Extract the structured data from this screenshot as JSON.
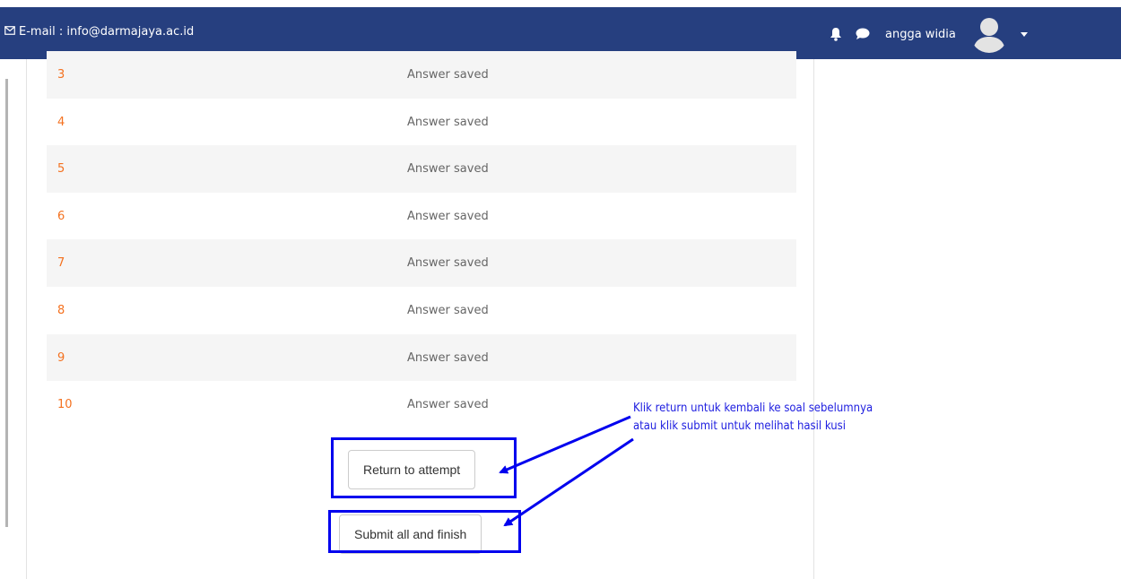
{
  "navbar": {
    "email": "E-mail : info@darmajaya.ac.id",
    "user_name": "angga widia",
    "icons": [
      "mail-icon",
      "bell-icon",
      "chat-icon",
      "avatar",
      "caret-down-icon"
    ],
    "bg_color": "#263f7f"
  },
  "summary": {
    "rows": [
      {
        "q": "3",
        "status": "Answer saved"
      },
      {
        "q": "4",
        "status": "Answer saved"
      },
      {
        "q": "5",
        "status": "Answer saved"
      },
      {
        "q": "6",
        "status": "Answer saved"
      },
      {
        "q": "7",
        "status": "Answer saved"
      },
      {
        "q": "8",
        "status": "Answer saved"
      },
      {
        "q": "9",
        "status": "Answer saved"
      },
      {
        "q": "10",
        "status": "Answer saved"
      }
    ],
    "number_color": "#f4711f"
  },
  "actions": {
    "return_label": "Return to attempt",
    "submit_label": "Submit all and finish"
  },
  "annotation": {
    "line1": "Klik return untuk kembali ke soal sebelumnya",
    "line2": "atau klik submit untuk melihat hasil kusi",
    "color": "#2020e0"
  }
}
